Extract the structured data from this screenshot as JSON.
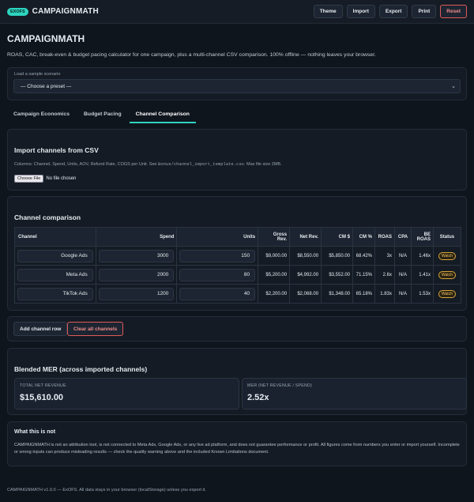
{
  "header": {
    "badge": "EXOFS",
    "brand": "CAMPAIGNMATH",
    "buttons": [
      "Theme",
      "Import",
      "Export",
      "Print",
      "Reset"
    ]
  },
  "page": {
    "title": "CAMPAIGNMATH",
    "subtitle": "ROAS, CAC, break-even & budget pacing calculator for one campaign, plus a multi-channel CSV comparison. 100% offline — nothing leaves your browser."
  },
  "preset": {
    "label": "Load a sample scenario",
    "selected": "— Choose a preset —"
  },
  "tabs": [
    {
      "label": "Campaign Economics",
      "active": false
    },
    {
      "label": "Budget Pacing",
      "active": false
    },
    {
      "label": "Channel Comparison",
      "active": true
    }
  ],
  "import": {
    "title": "Import channels from CSV",
    "columns_prefix": "Columns: Channel, Spend, Units, AOV, Refund Rate, COGS per Unit. See ",
    "template_path": "Bonus/channel_import_template.csv",
    "columns_suffix": ". Max file size 2MB.",
    "file_button": "Choose File",
    "file_status": "No file chosen"
  },
  "comparison": {
    "title": "Channel comparison",
    "headers": {
      "channel": "Channel",
      "spend": "Spend",
      "units": "Units",
      "gross_1": "Gross",
      "gross_2": "Rev.",
      "net": "Net Rev.",
      "cm": "CM $",
      "cm_pct": "CM %",
      "roas": "ROAS",
      "cpa": "CPA",
      "be_1": "BE",
      "be_2": "ROAS",
      "status": "Status"
    },
    "rows": [
      {
        "channel": "Google Ads",
        "spend": "3000",
        "units": "150",
        "gross": "$9,000.00",
        "net": "$8,550.00",
        "cm": "$5,850.00",
        "cm_pct": "68.42%",
        "roas": "3x",
        "cpa": "N/A",
        "be_roas": "1.46x",
        "status": "Watch"
      },
      {
        "channel": "Meta Ads",
        "spend": "2000",
        "units": "80",
        "gross": "$5,200.00",
        "net": "$4,992.00",
        "cm": "$3,552.00",
        "cm_pct": "71.15%",
        "roas": "2.6x",
        "cpa": "N/A",
        "be_roas": "1.41x",
        "status": "Watch"
      },
      {
        "channel": "TikTok Ads",
        "spend": "1200",
        "units": "40",
        "gross": "$2,200.00",
        "net": "$2,068.00",
        "cm": "$1,348.00",
        "cm_pct": "65.18%",
        "roas": "1.83x",
        "cpa": "N/A",
        "be_roas": "1.53x",
        "status": "Watch"
      }
    ]
  },
  "actions": {
    "add_row": "Add channel row",
    "clear": "Clear all channels"
  },
  "blended": {
    "title": "Blended MER (across imported channels)",
    "net_label": "TOTAL NET REVENUE",
    "net_value": "$15,610.00",
    "mer_label": "MER (NET REVENUE / SPEND)",
    "mer_value": "2.52x"
  },
  "disclaimer": {
    "title": "What this is not",
    "text": "CAMPAIGNMATH is not an attribution tool, is not connected to Meta Ads, Google Ads, or any live ad platform, and does not guarantee performance or profit. All figures come from numbers you enter or import yourself. Incomplete or wrong inputs can produce misleading results — check the quality warning above and the included Known Limitations document."
  },
  "footer": "CAMPAIGNMATH v1.0.0 — ExOFS. All data stays in your browser (localStorage) unless you export it.",
  "colors": {
    "accent": "#2dd4bf",
    "danger": "#e05a5a",
    "warn": "#d6a43a",
    "bg": "#0f151d"
  }
}
